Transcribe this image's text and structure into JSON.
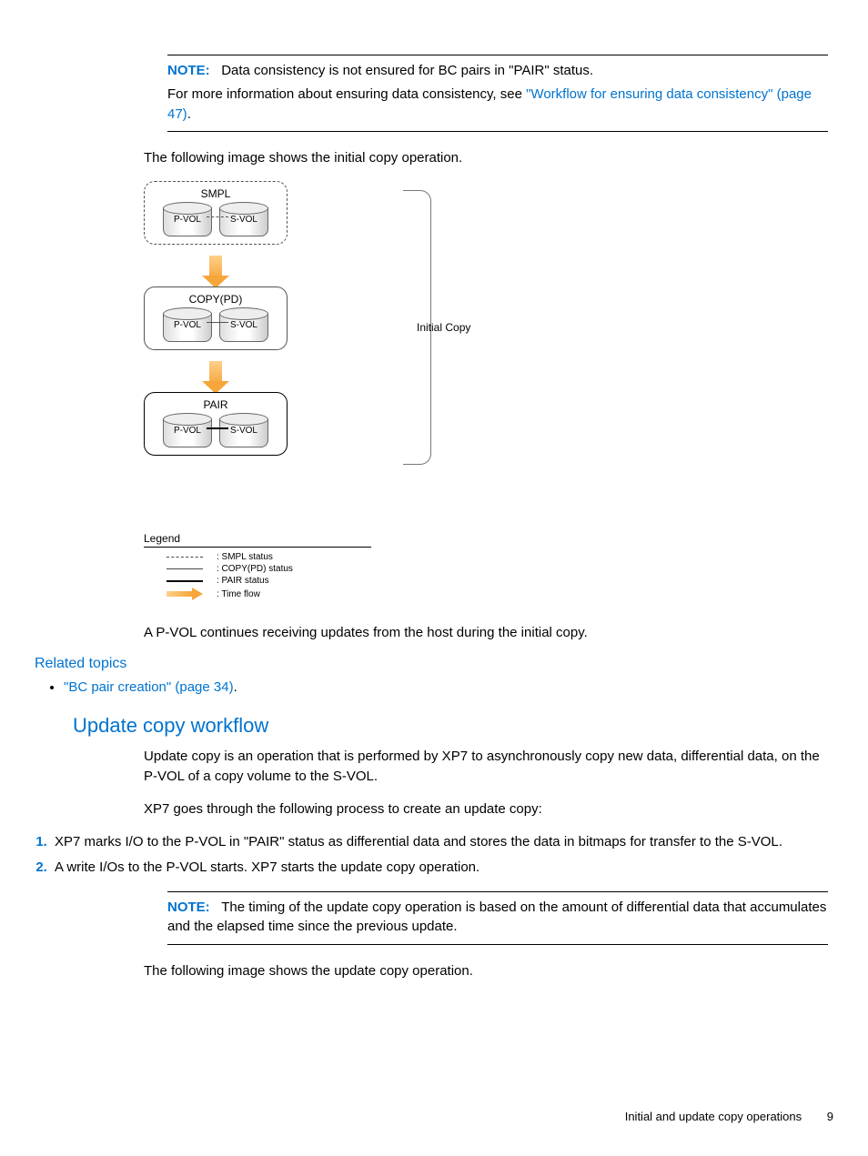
{
  "note1": {
    "label": "NOTE:",
    "text": "Data consistency is not ensured for BC pairs in \"PAIR\" status.",
    "more_pre": "For more information about ensuring data consistency, see ",
    "link": "\"Workflow for ensuring data consistency\" (page 47)",
    "more_post": "."
  },
  "p_intro_img": "The following image shows the initial copy operation.",
  "diagram": {
    "state1_title": "SMPL",
    "state2_title": "COPY(PD)",
    "state3_title": "PAIR",
    "pvol": "P-VOL",
    "svol": "S-VOL",
    "bracket_label": "Initial Copy",
    "legend_title": "Legend",
    "legend_items": [
      ": SMPL status",
      ": COPY(PD) status",
      ": PAIR status",
      ": Time flow"
    ]
  },
  "p_after_diag": "A P-VOL continues receiving updates from the host during the initial copy.",
  "related_heading": "Related topics",
  "related_items": [
    {
      "link": "\"BC pair creation\" (page 34)",
      "post": "."
    }
  ],
  "h2": "Update copy workflow",
  "p_update_intro": "Update copy is an operation that is performed by XP7 to asynchronously copy new data, differential data, on the P-VOL of a copy volume to the S-VOL.",
  "p_update_steps_intro": "XP7 goes through the following process to create an update copy:",
  "steps": [
    "XP7 marks I/O to the P-VOL in \"PAIR\" status as differential data and stores the data in bitmaps for transfer to the S-VOL.",
    "A write I/Os to the P-VOL starts. XP7 starts the update copy operation."
  ],
  "note2": {
    "label": "NOTE:",
    "text": "The timing of the update copy operation is based on the amount of differential data that accumulates and the elapsed time since the previous update."
  },
  "p_update_img": "The following image shows the update copy operation.",
  "footer": {
    "section": "Initial and update copy operations",
    "page": "9"
  }
}
